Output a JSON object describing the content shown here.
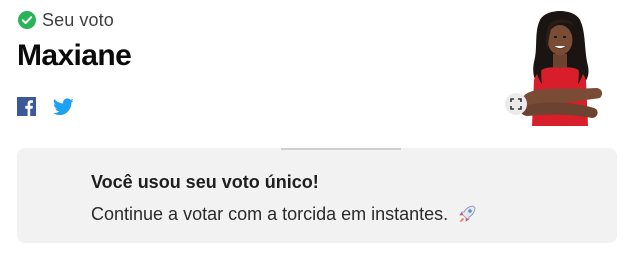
{
  "vote": {
    "status_label": "Seu voto",
    "candidate_name": "Maxiane"
  },
  "share": {
    "icons": [
      "facebook-icon",
      "twitter-icon"
    ]
  },
  "avatar": {
    "expand_icon": "expand-icon"
  },
  "message": {
    "title": "Você usou seu voto único!",
    "body": "Continue a votar com a torcida em instantes.",
    "icon": "rocket-icon"
  },
  "colors": {
    "check_green": "#2bb35a",
    "facebook_blue": "#3b5998",
    "twitter_blue": "#1da1f2",
    "card_background": "#f2f2f2",
    "avatar_dress_red": "#d81e2b"
  }
}
